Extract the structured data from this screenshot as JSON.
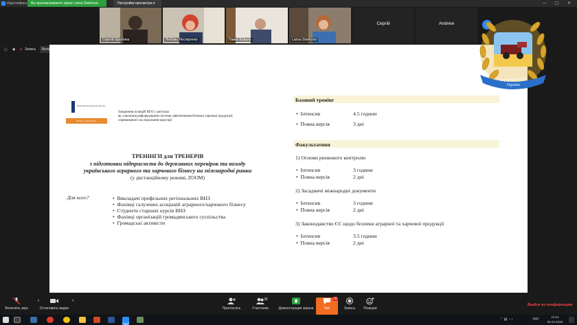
{
  "topbar": {
    "app_label": "Идентифика",
    "viewing_label": "Вы просматриваете экран Larisa Starikova",
    "view_options": "Настройки просмотра"
  },
  "participants": [
    {
      "name": "Сергей Щербина"
    },
    {
      "name": "Любовь Нестиренко"
    },
    {
      "name": "Павел Коваль"
    },
    {
      "name": "Larisa Starikova"
    },
    {
      "name": "Сергій"
    },
    {
      "name": "Andrew"
    }
  ],
  "recording": {
    "label": "Запись",
    "original_sound": "Включить оригинальный звук"
  },
  "logo": {
    "line1": "Аграрний союз",
    "line2": "України"
  },
  "slide": {
    "org_name": "Netherlands Enterprise Agency",
    "org_sub": "Ministry of Agriculture",
    "intro": [
      "Зміцнення позицій НГО у регіонах",
      "як учасників реформування системи забезпечення безпеки харчової продукції,",
      "спрямованого на подолання корупції"
    ],
    "title_lines": [
      "ТРЕНІНГИ для ТРЕНЕРІВ",
      "з підготовки підприємств до державних перевірок та виходу",
      "українського аграрного та харчового бізнесу на міжнародні ринки",
      "(у дистанційному режимі, ZOOM)"
    ],
    "for_whom_label": "Для кого?",
    "audience": [
      "Викладачі профільних регіональних ВНЗ",
      "Фахівці галузевих асоціацій аграрного/харчового бізнесу",
      "Студенти старших курсів ВНЗ",
      "Фахівці організацій громадянського суспільства",
      "Громадські активісти"
    ],
    "basic_title": "Базовий тренінг",
    "basic_rows": [
      {
        "label": "Інтенсив",
        "value": "4.5 години"
      },
      {
        "label": "Повна версія",
        "value": "3 дні"
      }
    ],
    "optional_title": "Факультативи",
    "optional_modules": [
      {
        "title": "1)   Основи ринкового контролю",
        "rows": [
          {
            "label": "Інтенсив",
            "value": "3 години"
          },
          {
            "label": "Повна версія",
            "value": "2 дні"
          }
        ]
      },
      {
        "title": "2)   Засадничі міжнародні документи",
        "rows": [
          {
            "label": "Інтенсив",
            "value": "3 години"
          },
          {
            "label": "Повна версія",
            "value": "2 дні"
          }
        ]
      },
      {
        "title": "3)   Законодавство ЄС щодо безпеки аграрної та харчової продукції",
        "rows": [
          {
            "label": "Інтенсив",
            "value": "3.5 години"
          },
          {
            "label": "Повна версія",
            "value": "2 дні"
          }
        ]
      }
    ]
  },
  "toolbar": {
    "unmute": "Включить звук",
    "stop_video": "Остановить видео",
    "invite": "Пригласить",
    "participants": "Участники",
    "participants_count": "38",
    "share": "Демонстрация экрана",
    "chat": "Чат",
    "chat_badge": "10",
    "record": "Запись",
    "reactions": "Реакции",
    "leave": "Выйти из конференции"
  },
  "taskbar": {
    "lang": "УКР",
    "time": "10:31",
    "date": "08.04.2020"
  },
  "colors": {
    "accent": "#2d8cff",
    "viewing_green": "#2e9e3e",
    "leave_red": "#ff4040",
    "chat_orange": "#f26d21",
    "section_bg": "#f9f3d8"
  }
}
